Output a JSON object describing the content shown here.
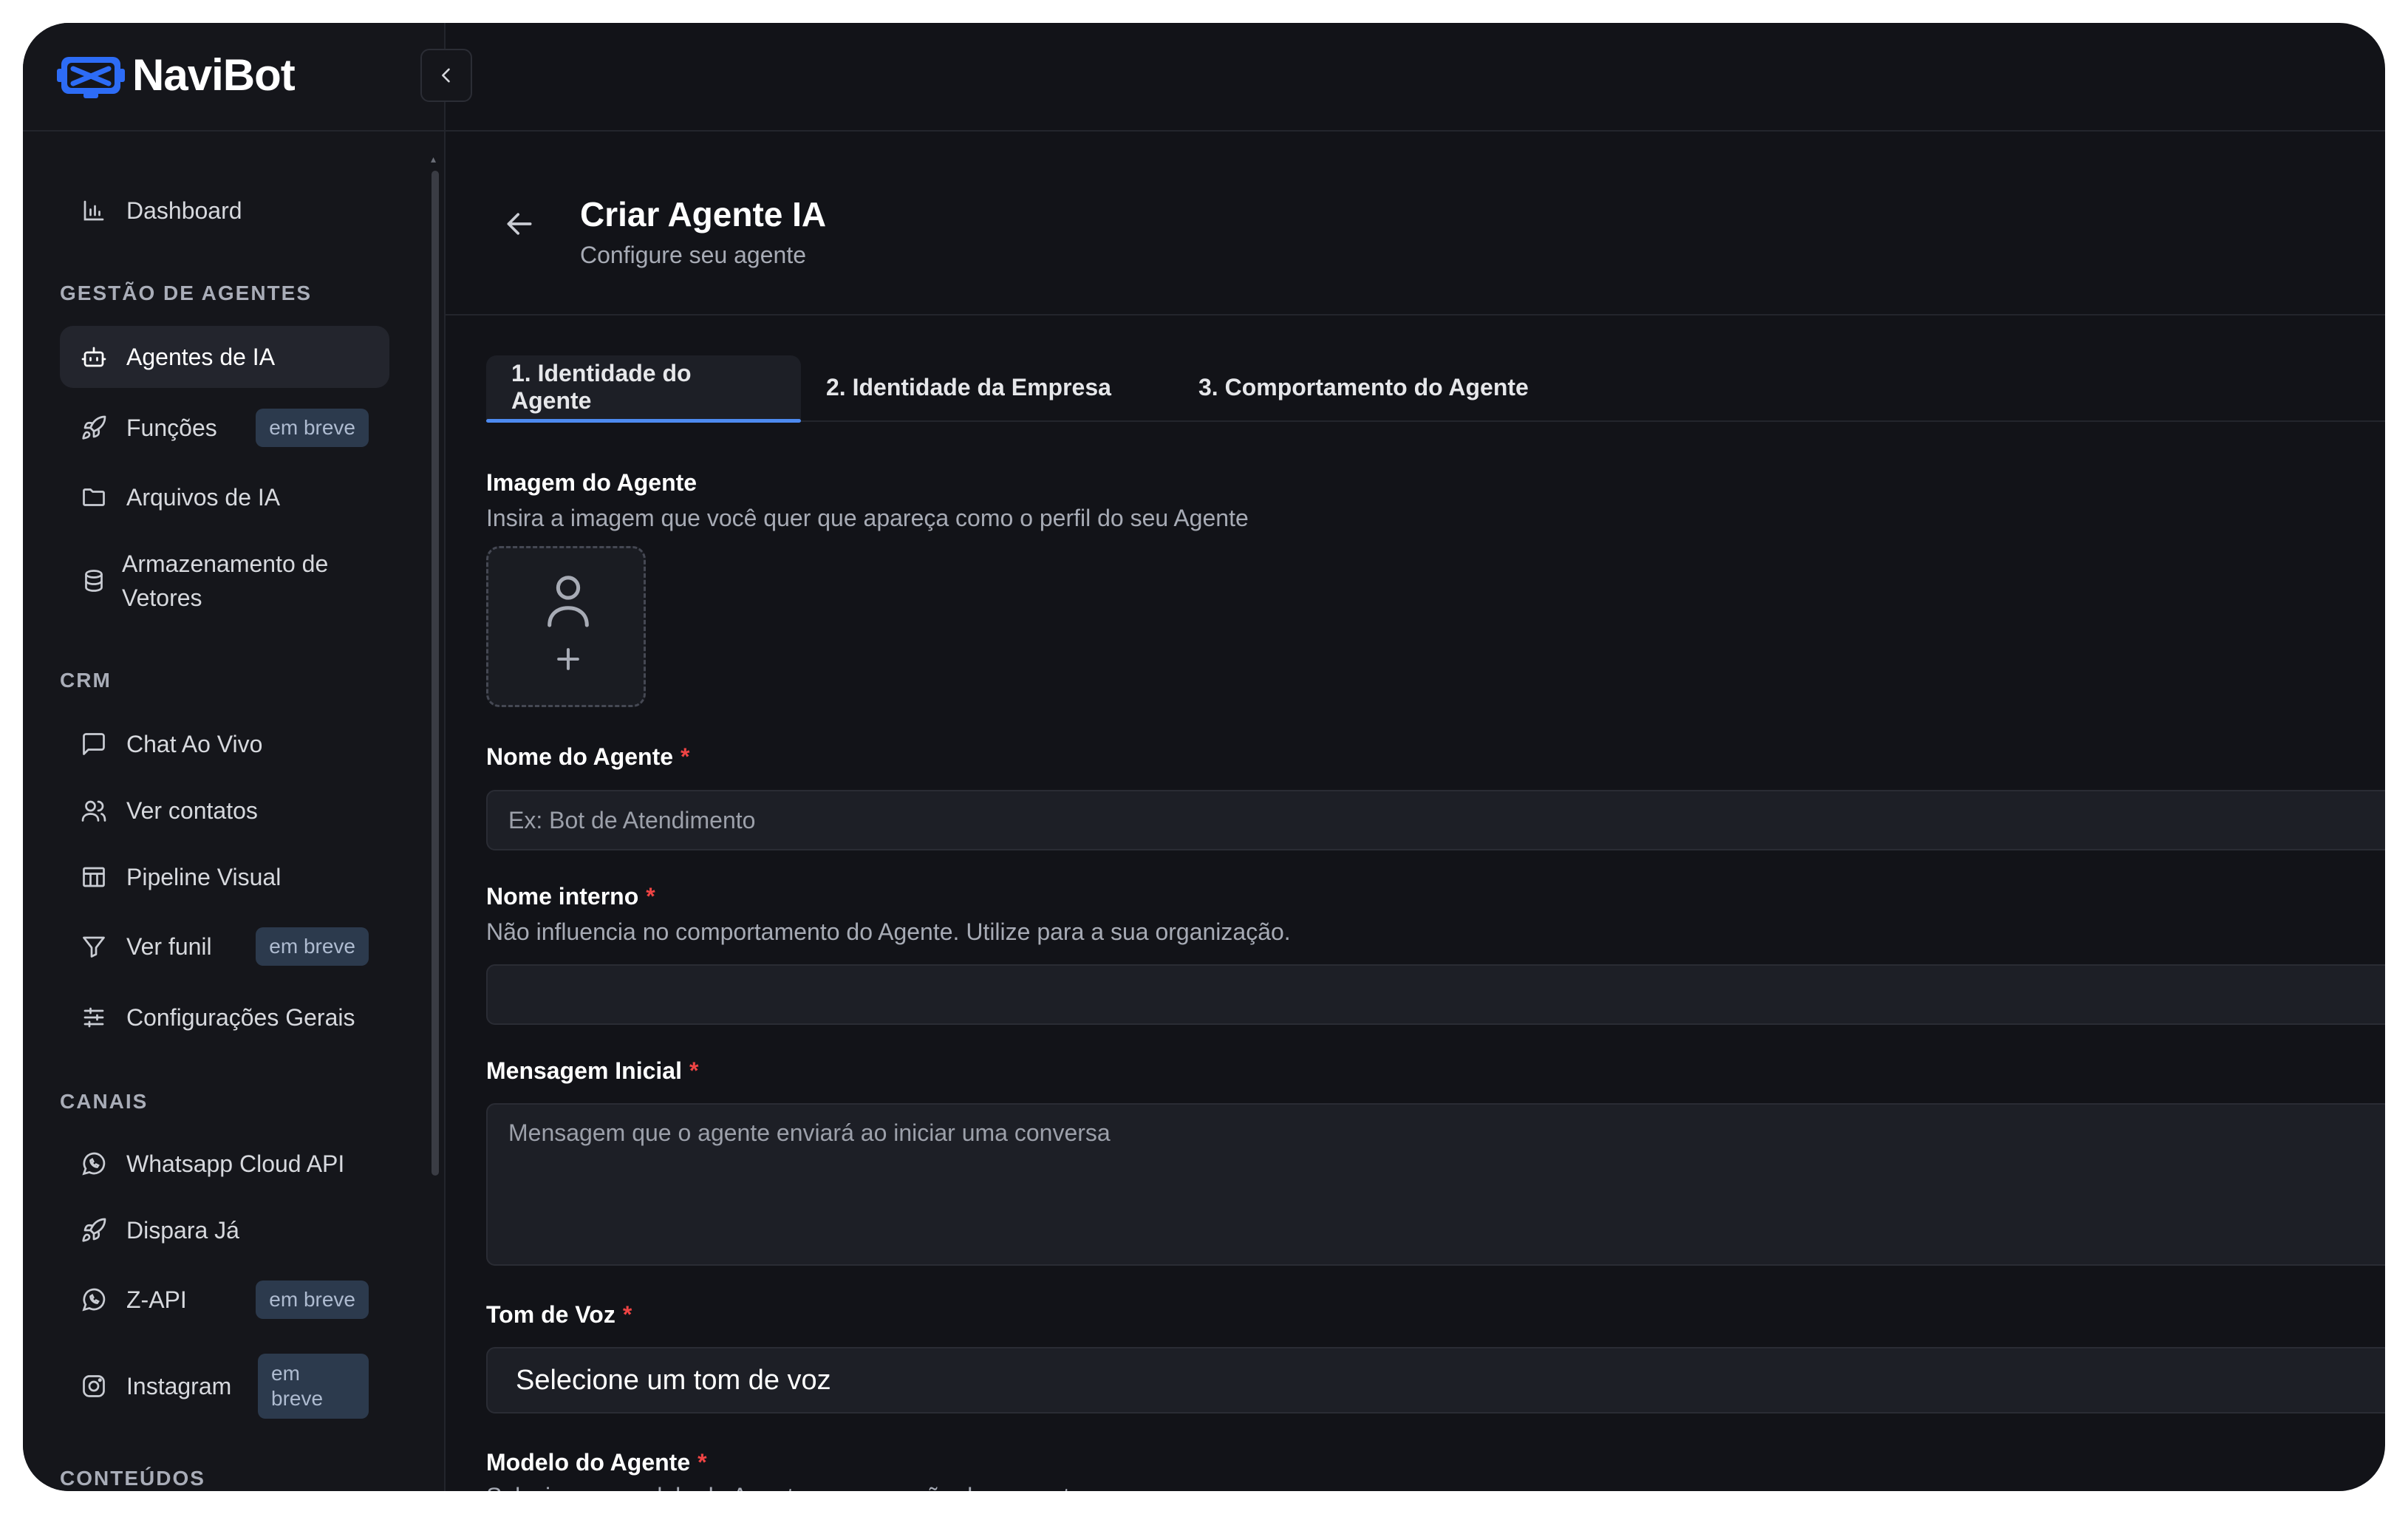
{
  "brand": {
    "name": "NaviBot"
  },
  "sidebar": {
    "top_items": [
      {
        "label": "Dashboard",
        "icon": "bar-chart-icon"
      }
    ],
    "sections": [
      {
        "title": "GESTÃO DE AGENTES",
        "items": [
          {
            "label": "Agentes de IA",
            "icon": "bot-icon",
            "active": true
          },
          {
            "label": "Funções",
            "icon": "rocket-icon",
            "badge": "em breve"
          },
          {
            "label": "Arquivos de IA",
            "icon": "folder-icon"
          },
          {
            "label": "Armazenamento de Vetores",
            "icon": "database-icon"
          }
        ]
      },
      {
        "title": "CRM",
        "items": [
          {
            "label": "Chat Ao Vivo",
            "icon": "message-square-icon"
          },
          {
            "label": "Ver contatos",
            "icon": "users-icon"
          },
          {
            "label": "Pipeline Visual",
            "icon": "columns-icon"
          },
          {
            "label": "Ver funil",
            "icon": "filter-icon",
            "badge": "em breve"
          },
          {
            "label": "Configurações Gerais",
            "icon": "sliders-icon"
          }
        ]
      },
      {
        "title": "CANAIS",
        "items": [
          {
            "label": "Whatsapp Cloud API",
            "icon": "whatsapp-icon"
          },
          {
            "label": "Dispara Já",
            "icon": "rocket-icon"
          },
          {
            "label": "Z-API",
            "icon": "whatsapp-icon",
            "badge": "em breve"
          },
          {
            "label": "Instagram",
            "icon": "instagram-icon",
            "badge": "em breve"
          }
        ]
      },
      {
        "title": "CONTEÚDOS",
        "items": []
      }
    ]
  },
  "header": {
    "title": "Criar Agente IA",
    "subtitle": "Configure seu agente"
  },
  "tabs": [
    {
      "label": "1. Identidade do Agente",
      "active": true
    },
    {
      "label": "2. Identidade da Empresa",
      "active": false
    },
    {
      "label": "3. Comportamento do Agente",
      "active": false
    }
  ],
  "form": {
    "image": {
      "label": "Imagem do Agente",
      "help": "Insira a imagem que você quer que apareça como o perfil do seu Agente"
    },
    "agent_name": {
      "label": "Nome do Agente",
      "required_mark": "*",
      "placeholder": "Ex: Bot de Atendimento",
      "value": ""
    },
    "internal_name": {
      "label": "Nome interno",
      "required_mark": "*",
      "help": "Não influencia no comportamento do Agente. Utilize para a sua organização.",
      "placeholder": "",
      "value": ""
    },
    "initial_message": {
      "label": "Mensagem Inicial",
      "required_mark": "*",
      "placeholder": "Mensagem que o agente enviará ao iniciar uma conversa",
      "value": ""
    },
    "voice_tone": {
      "label": "Tom de Voz",
      "required_mark": "*",
      "selected": "Selecione um tom de voz"
    },
    "agent_model": {
      "label": "Modelo do Agente",
      "required_mark": "*",
      "help": "Selecione o modelo do Agente para geração da resposta"
    }
  },
  "colors": {
    "background": "#121318",
    "sidebar": "#15161b",
    "accent": "#4d8af0",
    "required": "#ef4444",
    "badge_bg": "#2c3a4d"
  }
}
